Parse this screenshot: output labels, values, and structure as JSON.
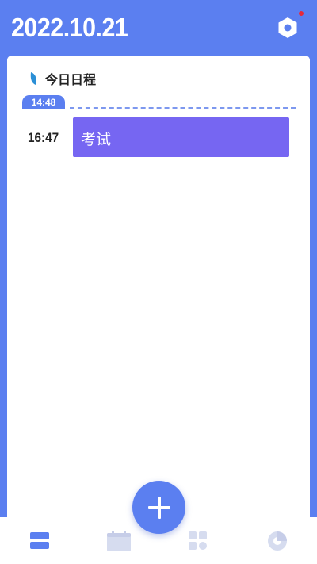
{
  "header": {
    "date": "2022.10.21",
    "settings_icon": "hexagon-gear-icon",
    "has_notification": true
  },
  "schedule": {
    "section_title": "今日日程",
    "current_time": "14:48",
    "events": [
      {
        "time": "16:47",
        "title": "考试",
        "color": "#7666f2"
      }
    ]
  },
  "fab": {
    "icon": "plus-icon"
  },
  "bottom_nav": {
    "items": [
      {
        "icon": "list-icon",
        "active": true
      },
      {
        "icon": "calendar-icon",
        "active": false
      },
      {
        "icon": "grid-icon",
        "active": false
      },
      {
        "icon": "pie-chart-icon",
        "active": false
      }
    ]
  },
  "colors": {
    "primary": "#5b7ff0",
    "event": "#7666f2",
    "inactive_icon": "#d6dcef",
    "notification": "#e8283a"
  }
}
